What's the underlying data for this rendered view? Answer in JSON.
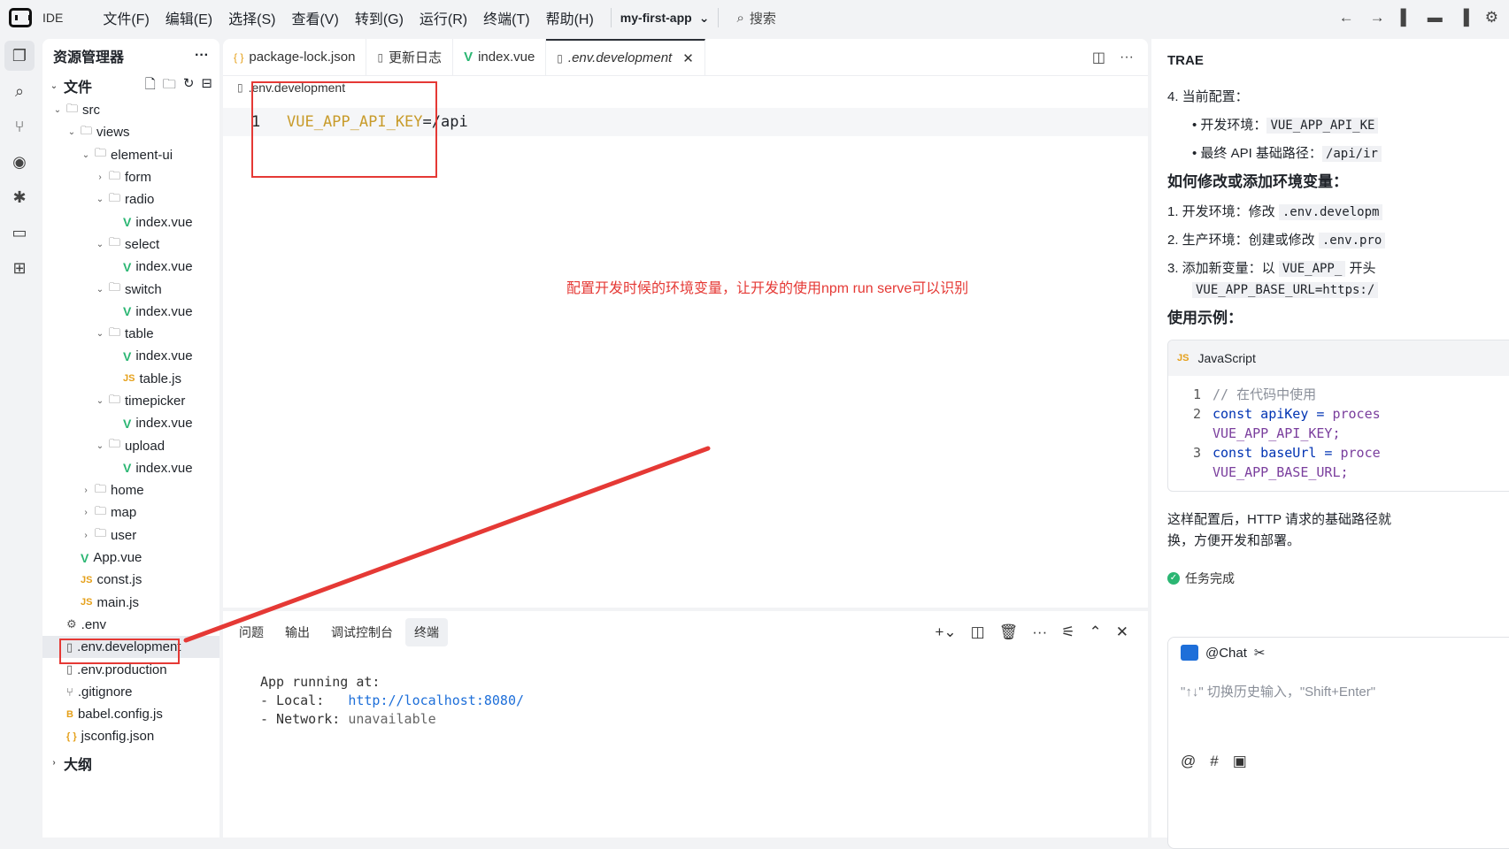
{
  "titlebar": {
    "ide": "IDE",
    "menu": [
      "文件(F)",
      "编辑(E)",
      "选择(S)",
      "查看(V)",
      "转到(G)",
      "运行(R)",
      "终端(T)",
      "帮助(H)"
    ],
    "project": "my-first-app",
    "search": "搜索"
  },
  "explorer": {
    "title": "资源管理器",
    "section": "文件",
    "outline": "大纲",
    "tree": [
      {
        "d": 0,
        "t": "folder",
        "open": true,
        "n": "src"
      },
      {
        "d": 1,
        "t": "folder",
        "open": true,
        "n": "views"
      },
      {
        "d": 2,
        "t": "folder",
        "open": true,
        "n": "element-ui"
      },
      {
        "d": 3,
        "t": "folder",
        "open": false,
        "n": "form"
      },
      {
        "d": 3,
        "t": "folder",
        "open": true,
        "n": "radio"
      },
      {
        "d": 4,
        "t": "vue",
        "n": "index.vue"
      },
      {
        "d": 3,
        "t": "folder",
        "open": true,
        "n": "select"
      },
      {
        "d": 4,
        "t": "vue",
        "n": "index.vue"
      },
      {
        "d": 3,
        "t": "folder",
        "open": true,
        "n": "switch"
      },
      {
        "d": 4,
        "t": "vue",
        "n": "index.vue"
      },
      {
        "d": 3,
        "t": "folder",
        "open": true,
        "n": "table"
      },
      {
        "d": 4,
        "t": "vue",
        "n": "index.vue"
      },
      {
        "d": 4,
        "t": "js",
        "n": "table.js"
      },
      {
        "d": 3,
        "t": "folder",
        "open": true,
        "n": "timepicker"
      },
      {
        "d": 4,
        "t": "vue",
        "n": "index.vue"
      },
      {
        "d": 3,
        "t": "folder",
        "open": true,
        "n": "upload"
      },
      {
        "d": 4,
        "t": "vue",
        "n": "index.vue"
      },
      {
        "d": 2,
        "t": "folder",
        "open": false,
        "n": "home"
      },
      {
        "d": 2,
        "t": "folder",
        "open": false,
        "n": "map"
      },
      {
        "d": 2,
        "t": "folder",
        "open": false,
        "n": "user"
      },
      {
        "d": 1,
        "t": "vue",
        "n": "App.vue"
      },
      {
        "d": 1,
        "t": "js",
        "n": "const.js"
      },
      {
        "d": 1,
        "t": "js",
        "n": "main.js"
      },
      {
        "d": 0,
        "t": "gear",
        "n": ".env"
      },
      {
        "d": 0,
        "t": "file",
        "n": ".env.development",
        "sel": true
      },
      {
        "d": 0,
        "t": "file",
        "n": ".env.production"
      },
      {
        "d": 0,
        "t": "git",
        "n": ".gitignore"
      },
      {
        "d": 0,
        "t": "babel",
        "n": "babel.config.js"
      },
      {
        "d": 0,
        "t": "json",
        "n": "jsconfig.json"
      }
    ]
  },
  "editor": {
    "tabs": [
      {
        "icon": "{ }",
        "label": "package-lock.json"
      },
      {
        "icon": "▯",
        "label": "更新日志"
      },
      {
        "icon": "V",
        "label": "index.vue"
      },
      {
        "icon": "▯",
        "label": ".env.development",
        "active": true
      }
    ],
    "breadcrumb": ".env.development",
    "line_no": "1",
    "code_key": "VUE_APP_API_KEY",
    "code_rest": "=/api",
    "annotation": "配置开发时候的环境变量，让开发的使用npm run serve可以识别"
  },
  "panel": {
    "tabs": [
      "问题",
      "输出",
      "调试控制台",
      "终端"
    ],
    "active_tab": "终端",
    "term_l1": "App running at:",
    "term_l2a": "- Local:   ",
    "term_l2b": "http://localhost:8080/",
    "term_l3a": "- Network: ",
    "term_l3b": "unavailable"
  },
  "chat": {
    "title": "TRAE",
    "item4": "4. 当前配置：",
    "b1a": "开发环境：",
    "b1b": "VUE_APP_API_KE",
    "b2a": "最终 API 基础路径：",
    "b2b": "/api/ir",
    "h_modify": "如何修改或添加环境变量：",
    "m1a": "1. 开发环境：修改",
    "m1b": ".env.developm",
    "m2a": "2. 生产环境：创建或修改",
    "m2b": ".env.pro",
    "m3a": "3. 添加新变量：以",
    "m3b": "VUE_APP_",
    "m3c": "开头",
    "m3d": "VUE_APP_BASE_URL=https:/",
    "h_example": "使用示例：",
    "code_lang": "JavaScript",
    "c1": "// 在代码中使用",
    "c2a": "const apiKey = ",
    "c2b": "proces",
    "c2c": "VUE_APP_API_KEY;",
    "c3a": "const baseUrl = ",
    "c3b": "proce",
    "c3c": "VUE_APP_BASE_URL;",
    "after1": "这样配置后，HTTP 请求的基础路径就",
    "after2": "换，方便开发和部署。",
    "done": "任务完成",
    "chat_label": "@Chat",
    "placeholder": "\"↑↓\" 切换历史输入，\"Shift+Enter\""
  }
}
